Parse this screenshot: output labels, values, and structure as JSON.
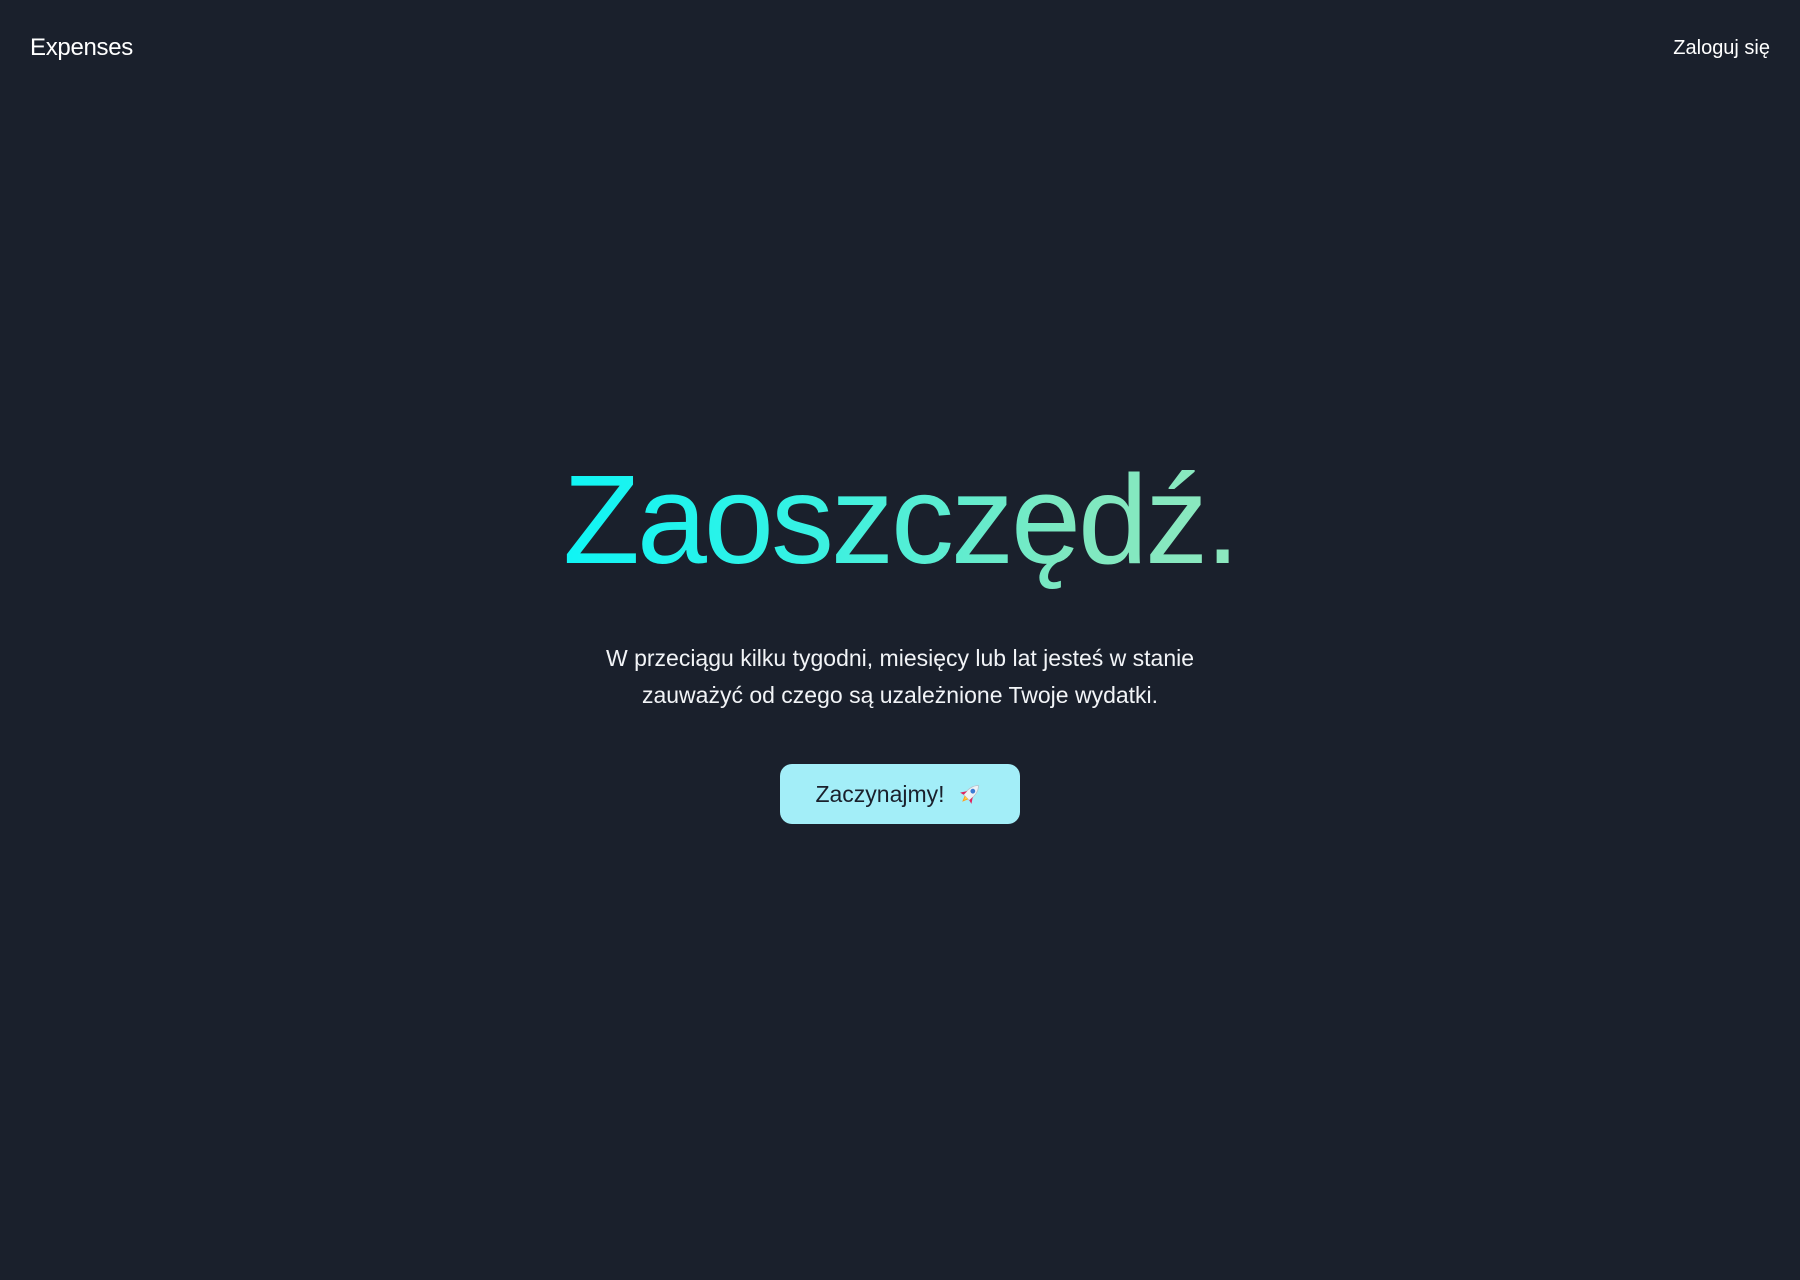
{
  "header": {
    "brand": "Expenses",
    "login_link": "Zaloguj się"
  },
  "hero": {
    "title": "Zaoszczędź.",
    "subtitle": "W przeciągu kilku tygodni, miesięcy lub lat jesteś w stanie zauważyć od czego są uzależnione Twoje wydatki.",
    "cta_label": "Zaczynajmy!",
    "cta_icon": "rocket-icon"
  },
  "colors": {
    "background": "#1a202c",
    "title_gradient_start": "#0ff5f5",
    "title_gradient_end": "#8de8bf",
    "cta_background": "#a3eef8",
    "cta_text": "#1a202c"
  }
}
